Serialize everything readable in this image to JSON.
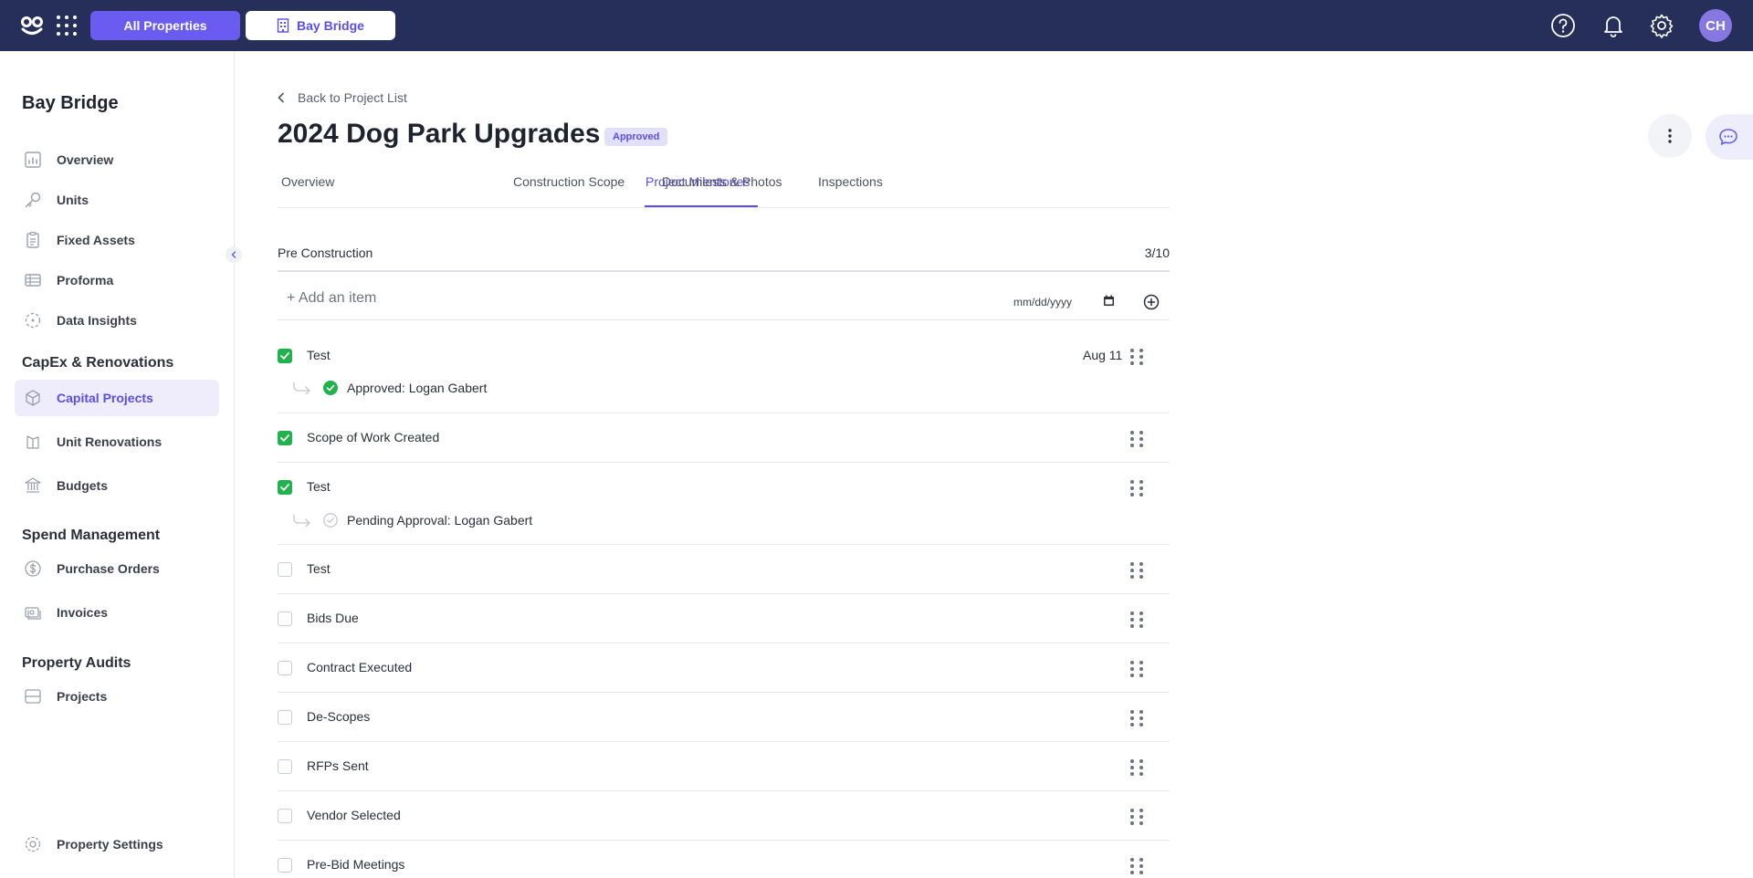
{
  "topbar": {
    "all_properties_label": "All Properties",
    "property_label": "Bay Bridge",
    "avatar_initials": "CH",
    "brand_color": "#262f5a",
    "accent_color": "#6a5cf0"
  },
  "sidebar": {
    "property_name": "Bay Bridge",
    "items": [
      {
        "label": "Overview",
        "icon": "chart-icon"
      },
      {
        "label": "Units",
        "icon": "key-icon"
      },
      {
        "label": "Fixed Assets",
        "icon": "clipboard-icon"
      },
      {
        "label": "Proforma",
        "icon": "table-icon"
      },
      {
        "label": "Data Insights",
        "icon": "insights-icon"
      }
    ],
    "capex_title": "CapEx & Renovations",
    "capex_items": [
      {
        "label": "Capital Projects",
        "icon": "box-icon",
        "active": true
      },
      {
        "label": "Unit Renovations",
        "icon": "renovation-icon"
      },
      {
        "label": "Budgets",
        "icon": "bank-icon"
      }
    ],
    "spend_title": "Spend Management",
    "spend_items": [
      {
        "label": "Purchase Orders",
        "icon": "dollar-icon"
      },
      {
        "label": "Invoices",
        "icon": "invoice-icon"
      }
    ],
    "audits_title": "Property Audits",
    "audits_items": [
      {
        "label": "Projects",
        "icon": "projects-icon"
      }
    ],
    "settings_label": "Property Settings"
  },
  "main": {
    "back_label": "Back to Project List",
    "title": "2024 Dog Park Upgrades",
    "status_badge": "Approved",
    "tabs": [
      {
        "label": "Overview"
      },
      {
        "label": "Project Milestones",
        "active": true
      },
      {
        "label": "Construction Scope"
      },
      {
        "label": "Documents & Photos"
      },
      {
        "label": "Inspections"
      }
    ],
    "section": {
      "name": "Pre Construction",
      "count": "3/10"
    },
    "add_item_placeholder": "+ Add an item",
    "date_placeholder": "mm/dd/yyyy",
    "milestones": [
      {
        "label": "Test",
        "checked": true,
        "date": "Aug 11",
        "approval": "Approved: Logan Gabert",
        "approval_state": "approved"
      },
      {
        "label": "Scope of Work Created",
        "checked": true
      },
      {
        "label": "Test",
        "checked": true,
        "approval": "Pending Approval: Logan Gabert",
        "approval_state": "pending"
      },
      {
        "label": "Test",
        "checked": false
      },
      {
        "label": "Bids Due",
        "checked": false
      },
      {
        "label": "Contract Executed",
        "checked": false
      },
      {
        "label": "De-Scopes",
        "checked": false
      },
      {
        "label": "RFPs Sent",
        "checked": false
      },
      {
        "label": "Vendor Selected",
        "checked": false
      },
      {
        "label": "Pre-Bid Meetings",
        "checked": false
      }
    ]
  }
}
